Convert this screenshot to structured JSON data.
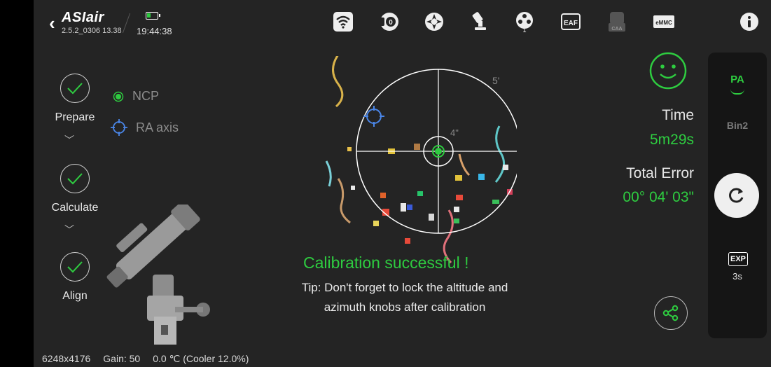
{
  "header": {
    "logo": "ASIair",
    "version": "2.5.2_0306 13.38",
    "time": "19:44:38",
    "icons": [
      "wifi-icon",
      "camera-icon",
      "guide-icon",
      "mount-icon",
      "filter-wheel-icon",
      "eaf-icon",
      "caa-icon",
      "emmc-icon",
      "info-icon"
    ],
    "filter_wheel_number": "1",
    "eaf_label": "EAF",
    "caa_label": "CAA",
    "emmc_label": "eMMC"
  },
  "steps": [
    {
      "label": "Prepare"
    },
    {
      "label": "Calculate"
    },
    {
      "label": "Align"
    }
  ],
  "legend": {
    "ncp": "NCP",
    "ra_axis": "RA axis"
  },
  "target": {
    "outer_label": "5'",
    "inner_label": "4\""
  },
  "stats": {
    "time_label": "Time",
    "time_value": "5m29s",
    "error_label": "Total Error",
    "error_value": "00° 04' 03\""
  },
  "side_panel": {
    "mode": "PA",
    "bin": "Bin2",
    "exp_badge": "EXP",
    "exp_value": "3s"
  },
  "message": {
    "title": "Calibration successful !",
    "tip_line1": "Tip: Don't forget to lock the altitude and",
    "tip_line2": "azimuth knobs after calibration"
  },
  "status": {
    "resolution": "6248x4176",
    "gain": "Gain: 50",
    "temperature": "0.0 ℃ (Cooler 12.0%)"
  },
  "colors": {
    "accent": "#2ecc40",
    "ra": "#4a86e8",
    "background": "#242424"
  }
}
